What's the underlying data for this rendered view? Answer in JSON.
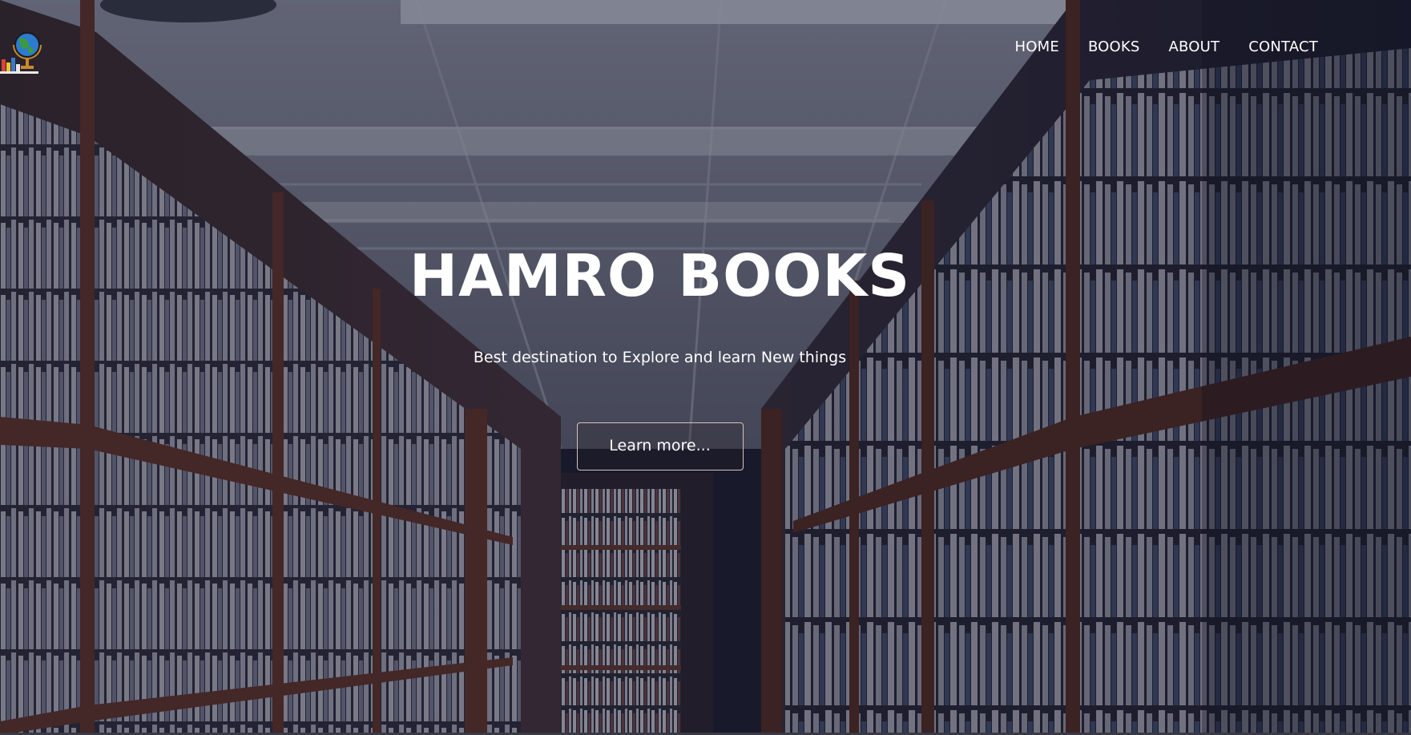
{
  "nav": {
    "items": [
      {
        "label": "HOME"
      },
      {
        "label": "BOOKS"
      },
      {
        "label": "ABOUT"
      },
      {
        "label": "CONTACT"
      }
    ]
  },
  "hero": {
    "title": "HAMRO BOOKS",
    "subtitle": "Best destination to Explore and learn New things",
    "button_label": "Learn more..."
  },
  "logo": {
    "icon": "globe-books-icon"
  },
  "colors": {
    "overlay": "#16182c",
    "text": "#ffffff",
    "button_border": "#d8c2bc",
    "shelf_wood": "#5a2a1c"
  }
}
